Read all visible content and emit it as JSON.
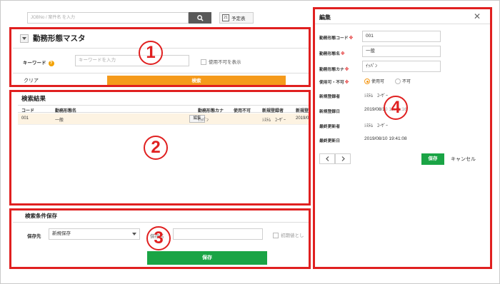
{
  "topbar": {
    "search_placeholder": "JOBNo / 案件名 を入力",
    "schedule_label": "予定表",
    "calendar_day": "21"
  },
  "panel1": {
    "title": "勤務形態マスタ",
    "keyword_label": "キーワード",
    "keyword_placeholder": "キーワードを入力",
    "show_unusable_label": "使用不可を表示",
    "clear_label": "クリア",
    "search_label": "検索",
    "callout": "1"
  },
  "panel2": {
    "title": "検索結果",
    "columns": [
      "コード",
      "勤務形態名",
      "勤務形態カナ",
      "使用不可",
      "新規登録者",
      "新規登"
    ],
    "rows": [
      {
        "code": "001",
        "name": "一般",
        "edit": "編集",
        "kana": "ｲｯﾊﾟﾝ",
        "unusable": "",
        "creator": "ｼｽﾃﾑ　ﾕｰｻﾞｰ",
        "created": "2019/0"
      }
    ],
    "callout": "2"
  },
  "panel3": {
    "title": "検索条件保存",
    "save_to_label": "保存先",
    "save_to_value": "新規保存",
    "save_name_label": "保存名",
    "default_label": "初期値とし",
    "save_button": "保存",
    "callout": "3"
  },
  "panel4": {
    "title": "編集",
    "fields": {
      "code_label": "勤務形態コード",
      "code_value": "001",
      "name_label": "勤務形態名",
      "name_value": "一般",
      "kana_label": "勤務形態カナ",
      "kana_value": "ｲｯﾊﾟﾝ",
      "usable_label": "使用可・不可",
      "usable_option": "使用可",
      "unusable_option": "不可",
      "created_by_label": "新規登録者",
      "created_by_value": "ｼｽﾃﾑ　ﾕｰｻﾞｰ",
      "created_at_label": "新規登録日",
      "created_at_value": "2019/08/10 19:41:16",
      "updated_by_label": "最終更新者",
      "updated_by_value": "ｼｽﾃﾑ　ﾕｰｻﾞｰ",
      "updated_at_label": "最終更新日",
      "updated_at_value": "2019/08/10 19:41:08"
    },
    "required_mark": "※",
    "save_button": "保存",
    "cancel_button": "キャンセル",
    "callout": "4"
  },
  "colors": {
    "accent_orange": "#f59a1b",
    "save_green": "#1aa445",
    "highlight_red": "#e02020",
    "row_highlight": "#fdf3e2"
  }
}
